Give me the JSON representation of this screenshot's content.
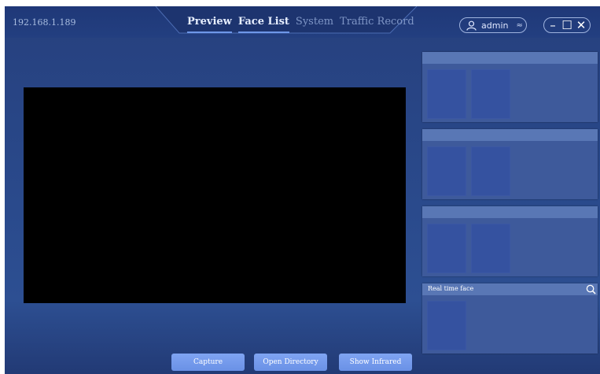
{
  "header": {
    "ip": "192.168.1.189",
    "tabs": [
      {
        "label": "Preview",
        "active": true
      },
      {
        "label": "Face List",
        "active": true
      },
      {
        "label": "System",
        "active": false
      },
      {
        "label": "Traffic Record",
        "active": false
      }
    ],
    "user": {
      "name": "admin",
      "icon": "user-icon",
      "switch_icon": "switch-icon"
    },
    "window_controls": {
      "minimize": "–",
      "maximize": "☐",
      "close": "✕"
    }
  },
  "right_panel": {
    "realtime_title": "Real time face",
    "search_icon": "search-icon"
  },
  "buttons": {
    "capture": "Capture",
    "open_directory": "Open Directory",
    "show_infrared": "Show Infrared"
  },
  "colors": {
    "background": "#2a4a8c",
    "panel": "#3e5a9b",
    "panel_header": "#5977b5",
    "button": "#7fa4f2",
    "video": "#000000"
  }
}
